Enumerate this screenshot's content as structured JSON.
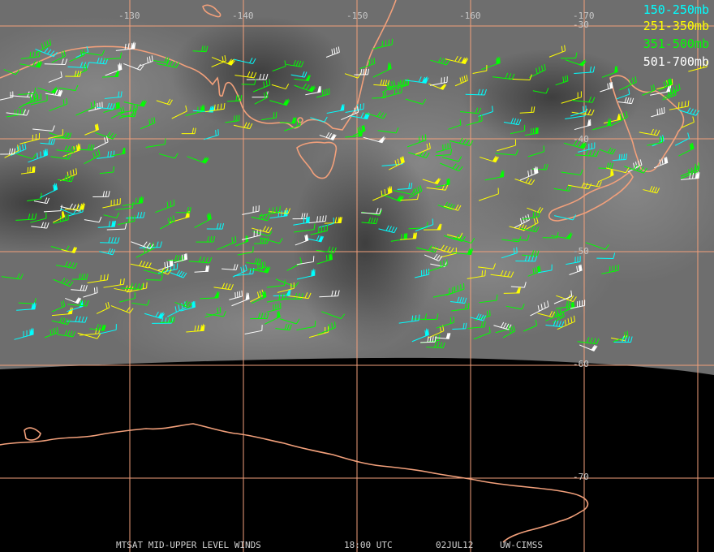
{
  "map": {
    "lon_labels": [
      "-130",
      "-140",
      "-150",
      "-160",
      "-170"
    ],
    "lat_labels": [
      "-30",
      "-40",
      "-50",
      "-60",
      "-70"
    ],
    "colors": {
      "grid": "#f2a07b",
      "coast": "#f2a07b",
      "band_150_250": "#00ffff",
      "band_251_350": "#ffff00",
      "band_351_500": "#00ff00",
      "band_501_700": "#ffffff"
    }
  },
  "legend": [
    {
      "label": "150-250mb",
      "color": "#00ffff"
    },
    {
      "label": "251-350mb",
      "color": "#ffff00"
    },
    {
      "label": "351-500mb",
      "color": "#00ff00"
    },
    {
      "label": "501-700mb",
      "color": "#ffffff"
    }
  ],
  "footer": {
    "product": "MTSAT MID-UPPER LEVEL WINDS",
    "time": "18:00 UTC",
    "date": "02JUL12",
    "source": "UW-CIMSS"
  }
}
